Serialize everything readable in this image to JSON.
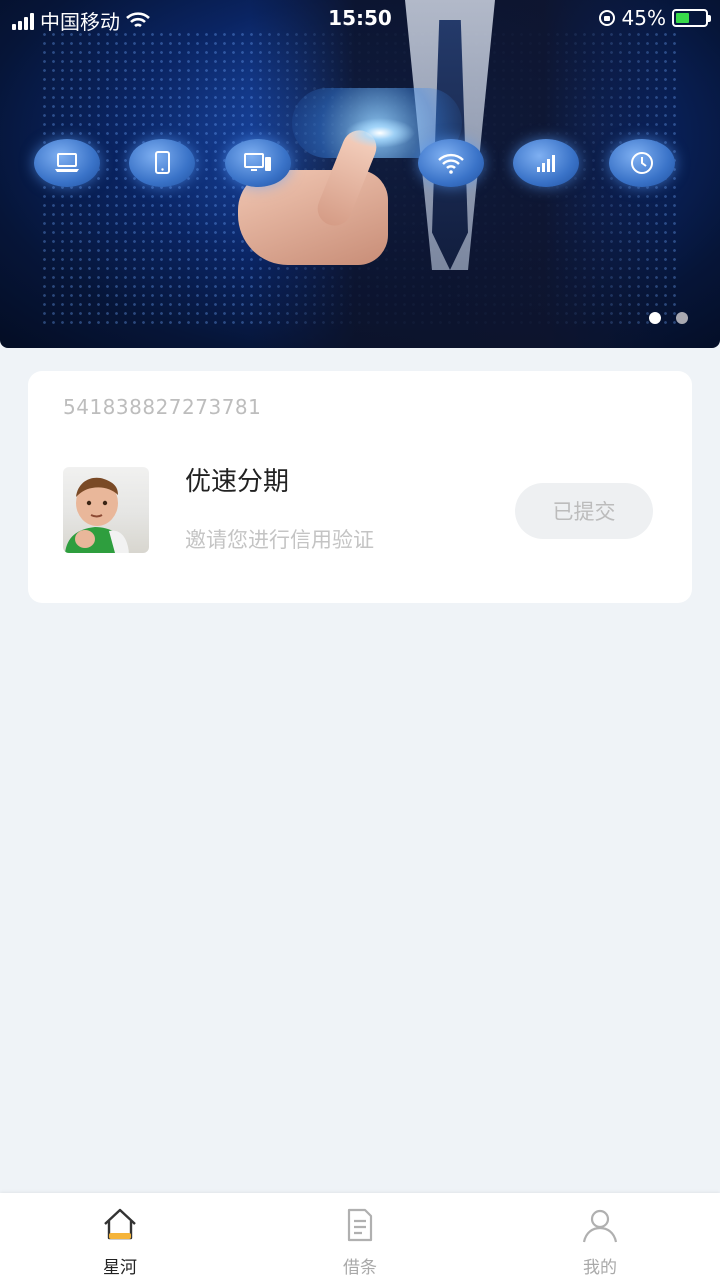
{
  "status_bar": {
    "carrier": "中国移动",
    "time": "15:50",
    "battery_percent": "45%",
    "battery_level": 0.45,
    "battery_color": "#38d94a"
  },
  "banner": {
    "icons": [
      "laptop-icon",
      "tablet-icon",
      "desktop-icon",
      "wifi-icon",
      "signal-icon",
      "clock-icon"
    ],
    "pages": 2,
    "active_page": 0
  },
  "card": {
    "order_number": "541838827273781",
    "title": "优速分期",
    "subtitle": "邀请您进行信用验证",
    "button_label": "已提交"
  },
  "tabbar": {
    "items": [
      {
        "label": "星河",
        "icon": "home-icon",
        "active": true
      },
      {
        "label": "借条",
        "icon": "document-icon",
        "active": false
      },
      {
        "label": "我的",
        "icon": "user-icon",
        "active": false
      }
    ],
    "accent_color": "#f5b43a"
  }
}
